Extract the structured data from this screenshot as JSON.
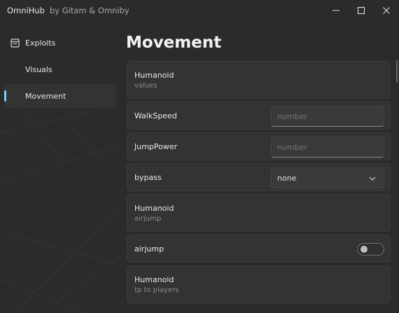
{
  "window": {
    "app_name": "OmniHub",
    "subtitle": "by Gitam & Omniby",
    "controls": {
      "minimize": "minimize-icon",
      "maximize": "maximize-icon",
      "close": "close-icon"
    }
  },
  "sidebar": {
    "items": [
      {
        "label": "Exploits",
        "icon": "document-icon",
        "active": false
      },
      {
        "label": "Visuals",
        "icon": "",
        "active": false
      },
      {
        "label": "Movement",
        "icon": "",
        "active": true
      }
    ]
  },
  "main": {
    "title": "Movement",
    "cards": [
      {
        "type": "paragraph",
        "title": "Humanoid",
        "desc": "values"
      },
      {
        "type": "input",
        "title": "WalkSpeed",
        "placeholder": "number"
      },
      {
        "type": "input",
        "title": "JumpPower",
        "placeholder": "number"
      },
      {
        "type": "dropdown",
        "title": "bypass",
        "value": "none"
      },
      {
        "type": "paragraph",
        "title": "Humanoid",
        "desc": "airjump"
      },
      {
        "type": "toggle",
        "title": "airjump",
        "on": false
      },
      {
        "type": "paragraph",
        "title": "Humanoid",
        "desc": "tp to players"
      }
    ]
  },
  "colors": {
    "background": "#2b2b2b",
    "card": "#333333",
    "accent": "#7ecbff",
    "text": "#e8e8e8",
    "muted": "#8c8c8c"
  }
}
